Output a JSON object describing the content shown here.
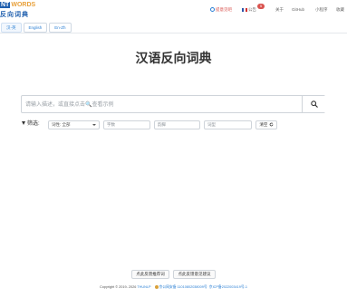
{
  "logo": {
    "top_part1": "NT",
    "top_part2": "WORDS",
    "bottom": "反向词典"
  },
  "nav": {
    "feedback": "提意见吧",
    "notice": "公告",
    "notice_badge": "5",
    "about": "关于",
    "github": "GitHub",
    "miniprogram": "小程序",
    "favorite": "收藏"
  },
  "lang_tabs": [
    "汉-英",
    "English",
    "En-Zh"
  ],
  "title": "汉语反向词典",
  "search": {
    "placeholder": "请输入描述，或直接点击🔍查看示例"
  },
  "filter": {
    "label": "筛选:",
    "pos_selected": "词性: 全部",
    "char_placeholder": "字数",
    "rhyme_placeholder": "韵脚",
    "synonym_placeholder": "词型",
    "clear_label": "清空"
  },
  "footer": {
    "button1": "点此反馈推荐词",
    "button2": "点此反馈意见建议",
    "copyright": "Copyright © 2019- 2026",
    "org": "THUNLP",
    "police": "京公网安备 11010802038009号",
    "icp": "京ICP备2022003419号-1"
  },
  "colors": {
    "accent": "#2a7fd4",
    "brand_blue": "#1f5fae",
    "brand_orange": "#e8a03a",
    "badge_red": "#d9534f"
  }
}
